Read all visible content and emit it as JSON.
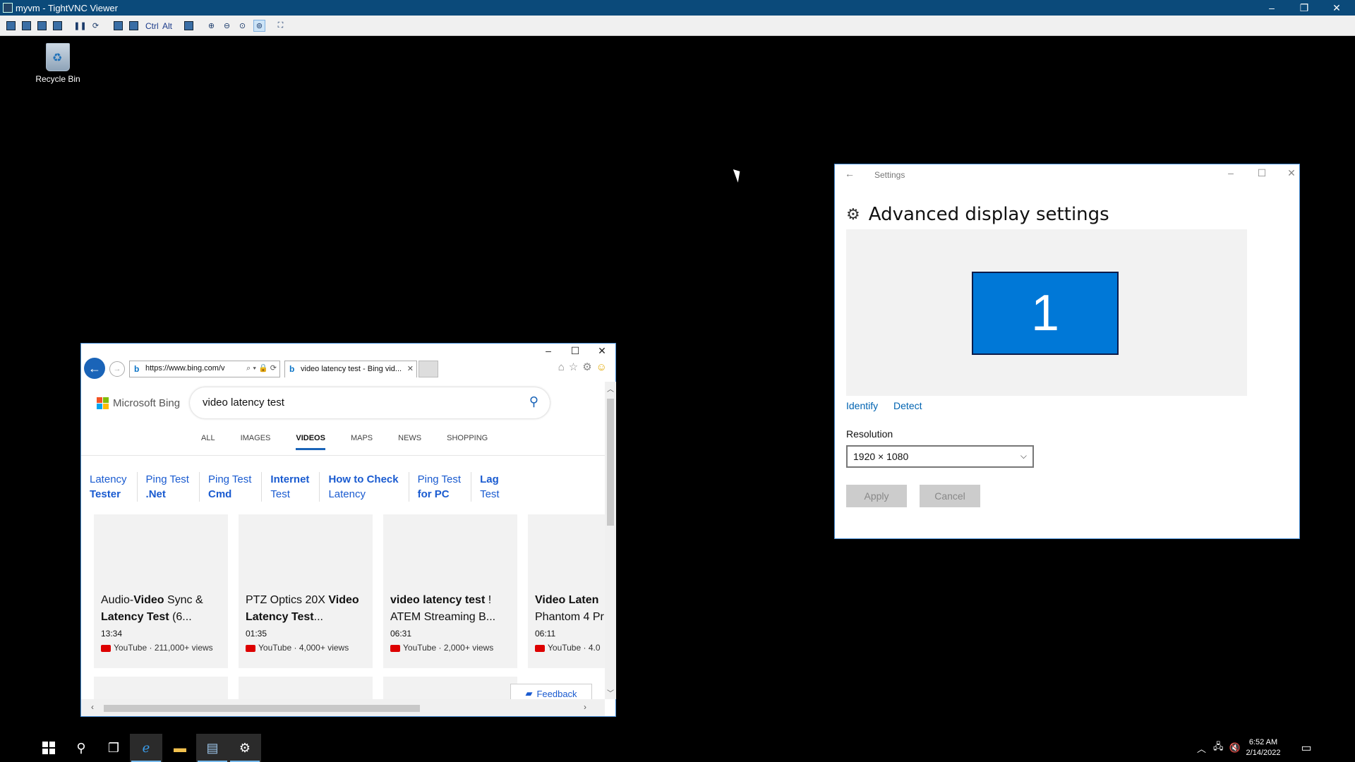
{
  "vnc": {
    "title": "myvm - TightVNC Viewer",
    "toolbar_ctrl": "Ctrl",
    "toolbar_alt": "Alt",
    "minimize": "–",
    "restore": "❐",
    "close": "✕"
  },
  "desktop": {
    "recycle_bin_label": "Recycle Bin"
  },
  "settings": {
    "app_title": "Settings",
    "heading": "Advanced display settings",
    "monitor_number": "1",
    "identify": "Identify",
    "detect": "Detect",
    "resolution_label": "Resolution",
    "resolution_value": "1920 × 1080",
    "apply": "Apply",
    "cancel": "Cancel",
    "accent": "#0078d7"
  },
  "browser": {
    "address": "https://www.bing.com/v",
    "tab_title": "video latency test - Bing vid...",
    "brand": "Microsoft Bing",
    "query": "video latency test",
    "nav": [
      "ALL",
      "IMAGES",
      "VIDEOS",
      "MAPS",
      "NEWS",
      "SHOPPING"
    ],
    "nav_active": "VIDEOS",
    "related": [
      {
        "line1": "Latency",
        "line2": "Tester"
      },
      {
        "line1": "Ping Test",
        "line2": ".Net"
      },
      {
        "line1": "Ping Test",
        "line2": "Cmd"
      },
      {
        "line1": "Internet",
        "line2": "Test"
      },
      {
        "line1": "How to Check",
        "line2": "Latency"
      },
      {
        "line1": "Ping Test",
        "line2": "for PC"
      },
      {
        "line1": "Lag",
        "line2": "Test"
      }
    ],
    "videos": [
      {
        "title_a": "Audio-",
        "title_b": "Video",
        "title_c": " Sync &",
        "title2_b": "Latency Test",
        "title2_c": " (6...",
        "duration": "13:34",
        "meta": "YouTube · 211,000+ views"
      },
      {
        "title_a": "PTZ Optics 20X ",
        "title_b": "Video",
        "title_c": "",
        "title2_b": "Latency Test",
        "title2_c": "...",
        "duration": "01:35",
        "meta": "YouTube · 4,000+ views"
      },
      {
        "title_a": "",
        "title_b": "video latency test",
        "title_c": " !",
        "title2_b": "",
        "title2_c": "ATEM Streaming B...",
        "duration": "06:31",
        "meta": "YouTube · 2,000+ views"
      },
      {
        "title_a": "",
        "title_b": "Video Laten",
        "title_c": "",
        "title2_b": "",
        "title2_c": "Phantom 4 Pr",
        "duration": "06:11",
        "meta": "YouTube · 4.0"
      }
    ],
    "feedback": "Feedback"
  },
  "taskbar": {
    "time": "6:52 AM",
    "date": "2/14/2022"
  }
}
